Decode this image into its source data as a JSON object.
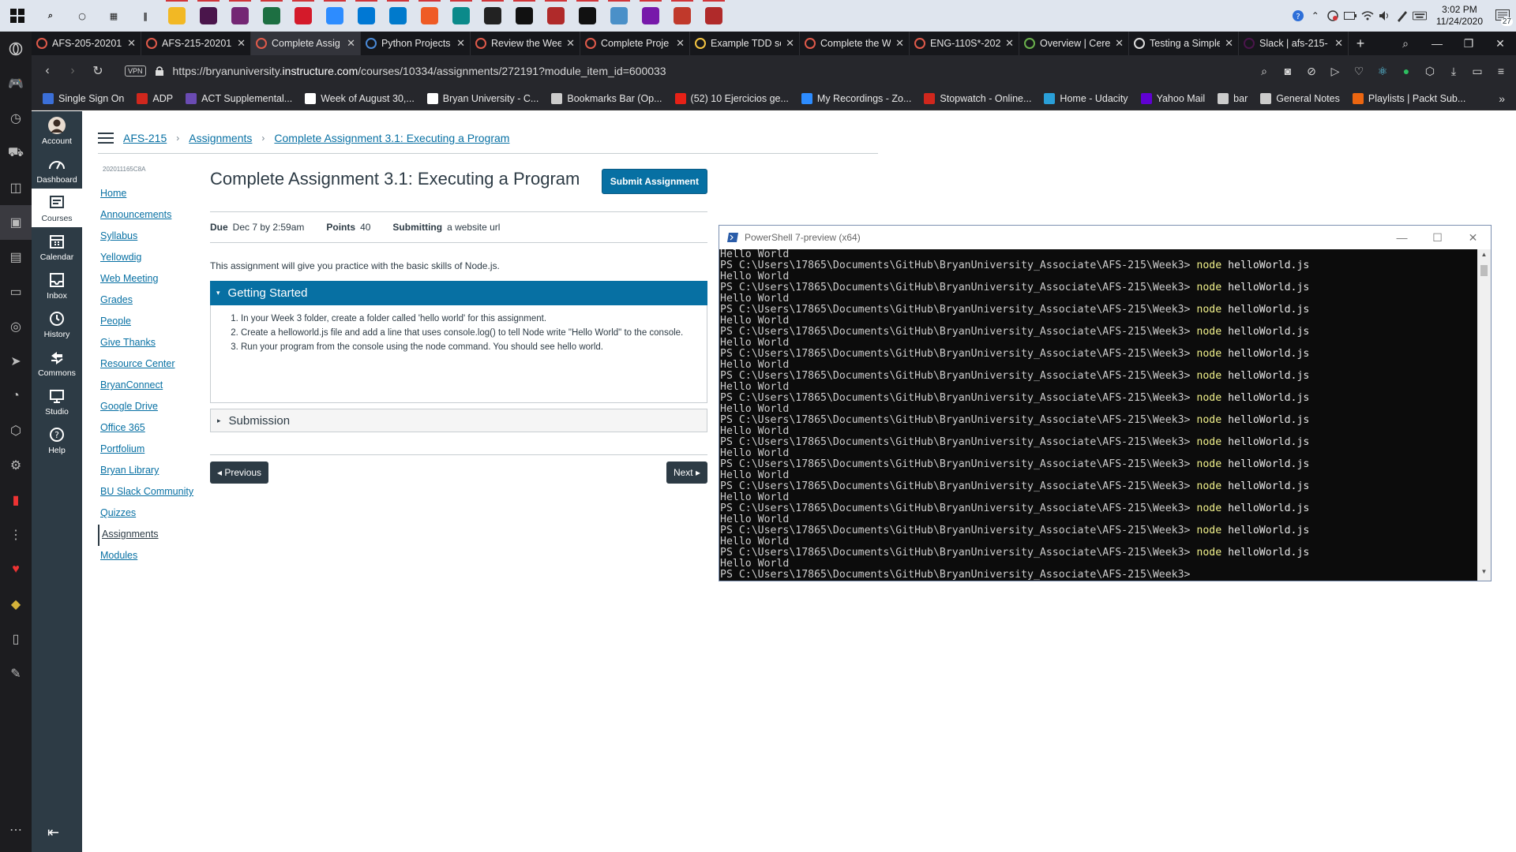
{
  "taskbar": {
    "apps": [
      {
        "name": "search-icon",
        "color": "#222"
      },
      {
        "name": "cortana-icon",
        "color": "#222"
      },
      {
        "name": "task-view-icon",
        "color": "#222"
      },
      {
        "name": "divider-icon",
        "color": "#222"
      },
      {
        "name": "file-explorer-icon",
        "color": "#f2b824"
      },
      {
        "name": "slack-icon",
        "color": "#4a154b"
      },
      {
        "name": "power-apps-icon",
        "color": "#742774"
      },
      {
        "name": "excel-icon",
        "color": "#1d6f42"
      },
      {
        "name": "opera-icon",
        "color": "#d41a2a"
      },
      {
        "name": "zoom-icon",
        "color": "#2d8cff"
      },
      {
        "name": "store-icon",
        "color": "#0078d4"
      },
      {
        "name": "vscode-icon",
        "color": "#007acc"
      },
      {
        "name": "postman-icon",
        "color": "#ef5b25"
      },
      {
        "name": "edge-icon",
        "color": "#0b8a8a"
      },
      {
        "name": "sticky-notes-icon",
        "color": "#222"
      },
      {
        "name": "webstorm-icon",
        "color": "#111"
      },
      {
        "name": "app-red-icon",
        "color": "#b02a2a"
      },
      {
        "name": "app-dark-icon",
        "color": "#111"
      },
      {
        "name": "remote-desktop-icon",
        "color": "#4a90c8"
      },
      {
        "name": "onenote-icon",
        "color": "#7719aa"
      },
      {
        "name": "paint-icon",
        "color": "#c0392b"
      },
      {
        "name": "app-red2-icon",
        "color": "#b02a2a"
      }
    ],
    "clock_time": "3:02 PM",
    "clock_date": "11/24/2020",
    "notifications": "27"
  },
  "tabs": [
    {
      "title": "AFS-205-20201",
      "fav": "#e05a4a",
      "active": false
    },
    {
      "title": "AFS-215-20201",
      "fav": "#e05a4a",
      "active": false
    },
    {
      "title": "Complete Assig",
      "fav": "#e05a4a",
      "active": true
    },
    {
      "title": "Python Projects",
      "fav": "#4a8ad8",
      "active": false
    },
    {
      "title": "Review the Wee",
      "fav": "#e05a4a",
      "active": false
    },
    {
      "title": "Complete Proje",
      "fav": "#e05a4a",
      "active": false
    },
    {
      "title": "Example TDD sc",
      "fav": "#f5c542",
      "active": false
    },
    {
      "title": "Complete the W",
      "fav": "#e05a4a",
      "active": false
    },
    {
      "title": "ENG-110S*-202",
      "fav": "#e05a4a",
      "active": false
    },
    {
      "title": "Overview | Cere",
      "fav": "#6ab04c",
      "active": false
    },
    {
      "title": "Testing a Simple",
      "fav": "#dddddd",
      "active": false
    },
    {
      "title": "Slack | afs-215-",
      "fav": "#4a154b",
      "active": false
    }
  ],
  "address": {
    "vpn": "VPN",
    "url_prefix": "https://bryanuniversity.",
    "url_domain": "instructure.com",
    "url_path": "/courses/10334/assignments/272191?module_item_id=600033"
  },
  "bookmarks": [
    {
      "label": "Single Sign On",
      "color": "#3b6fd8"
    },
    {
      "label": "ADP",
      "color": "#d0271d"
    },
    {
      "label": "ACT Supplemental...",
      "color": "#6a4bb3"
    },
    {
      "label": "Week of August 30,...",
      "color": "#ffffff"
    },
    {
      "label": "Bryan University - C...",
      "color": "#ffffff"
    },
    {
      "label": "Bookmarks Bar (Op...",
      "color": "#cccccc"
    },
    {
      "label": "(52) 10 Ejercicios ge...",
      "color": "#e62117"
    },
    {
      "label": "My Recordings - Zo...",
      "color": "#2d8cff"
    },
    {
      "label": "Stopwatch - Online...",
      "color": "#d0271d"
    },
    {
      "label": "Home - Udacity",
      "color": "#2a9fd8"
    },
    {
      "label": "Yahoo Mail",
      "color": "#6001d2"
    },
    {
      "label": "bar",
      "color": "#cccccc"
    },
    {
      "label": "General Notes",
      "color": "#cccccc"
    },
    {
      "label": "Playlists | Packt Sub...",
      "color": "#ec6611"
    }
  ],
  "globalnav": [
    {
      "label": "Account",
      "icon": "avatar"
    },
    {
      "label": "Dashboard",
      "icon": "dashboard-icon"
    },
    {
      "label": "Courses",
      "icon": "courses-icon"
    },
    {
      "label": "Calendar",
      "icon": "calendar-icon"
    },
    {
      "label": "Inbox",
      "icon": "inbox-icon"
    },
    {
      "label": "History",
      "icon": "history-icon"
    },
    {
      "label": "Commons",
      "icon": "commons-icon"
    },
    {
      "label": "Studio",
      "icon": "studio-icon"
    },
    {
      "label": "Help",
      "icon": "help-icon"
    }
  ],
  "breadcrumb": {
    "course": "AFS-215",
    "section": "Assignments",
    "page": "Complete Assignment 3.1: Executing a Program"
  },
  "coursenav": {
    "code": "202011165C8A",
    "links": [
      "Home",
      "Announcements",
      "Syllabus",
      "Yellowdig",
      "Web Meeting",
      "Grades",
      "People",
      "Give Thanks",
      "Resource Center",
      "BryanConnect",
      "Google Drive",
      "Office 365",
      "Portfolium",
      "Bryan Library",
      "BU Slack Community",
      "Quizzes",
      "Assignments",
      "Modules"
    ],
    "active": "Assignments"
  },
  "assignment": {
    "title": "Complete Assignment 3.1: Executing a Program",
    "submit_label": "Submit Assignment",
    "due_label": "Due",
    "due_value": "Dec 7 by 2:59am",
    "points_label": "Points",
    "points_value": "40",
    "submitting_label": "Submitting",
    "submitting_value": "a website url",
    "description": "This assignment will give you practice with the basic skills of Node.js.",
    "section1": "Getting Started",
    "steps": [
      "In your Week 3 folder, create a folder called 'hello world' for this assignment.",
      "Create a helloworld.js file and add a line that uses console.log() to tell Node write \"Hello World\" to the console.",
      "Run your program from the console using the node command. You should see hello world."
    ],
    "section2": "Submission",
    "prev_label": "◂ Previous",
    "next_label": "Next ▸"
  },
  "powershell": {
    "title": "PowerShell 7-preview (x64)",
    "prompt": "PS C:\\Users\\17865\\Documents\\GitHub\\BryanUniversity_Associate\\AFS-215\\Week3>",
    "command": "node",
    "argument": "helloWorld.js",
    "output": "Hello World",
    "repeat_count": 14
  }
}
